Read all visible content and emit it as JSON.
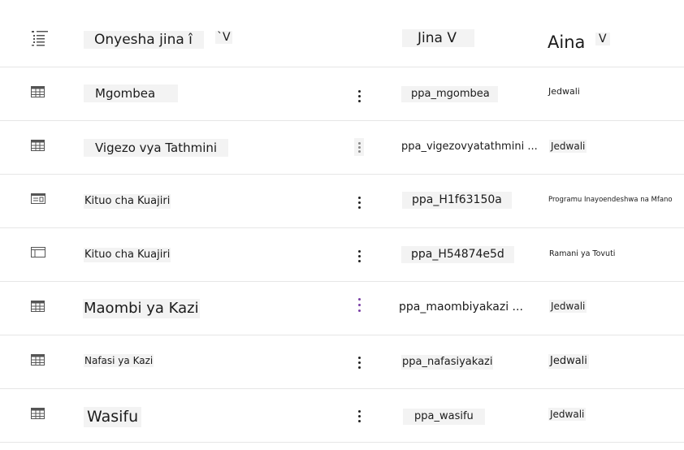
{
  "header": {
    "list_icon": "list-icon",
    "col_display_name": "Onyesha jina î",
    "col_display_name_sort": "`V",
    "col_name": "Jina V",
    "col_type": "Aina",
    "col_type_sort": "V"
  },
  "rows": [
    {
      "icon": "table-icon",
      "display_name": "Mgombea",
      "name": "ppa_mgombea",
      "type": "Jedwali"
    },
    {
      "icon": "table-icon",
      "display_name": "Vigezo vya Tathmini",
      "name": "ppa_vigezovyatathmini ...",
      "type": "Jedwali"
    },
    {
      "icon": "model-app-icon",
      "display_name": "Kituo cha Kuajiri",
      "name": "ppa_H1f63150a",
      "type": "Programu Inayoendeshwa na Mfano"
    },
    {
      "icon": "site-map-icon",
      "display_name": "Kituo cha Kuajiri",
      "name": "ppa_H54874e5d",
      "type": "Ramani ya Tovuti"
    },
    {
      "icon": "table-icon",
      "display_name": "Maombi ya Kazi",
      "name": "ppa_maombiyakazi ...",
      "type": "Jedwali"
    },
    {
      "icon": "table-icon",
      "display_name": "Nafasi ya Kazi",
      "name": "ppa_nafasiyakazi",
      "type": "Jedwali"
    },
    {
      "icon": "table-icon",
      "display_name": "Wasifu",
      "name": "ppa_wasifu",
      "type": "Jedwali"
    }
  ]
}
